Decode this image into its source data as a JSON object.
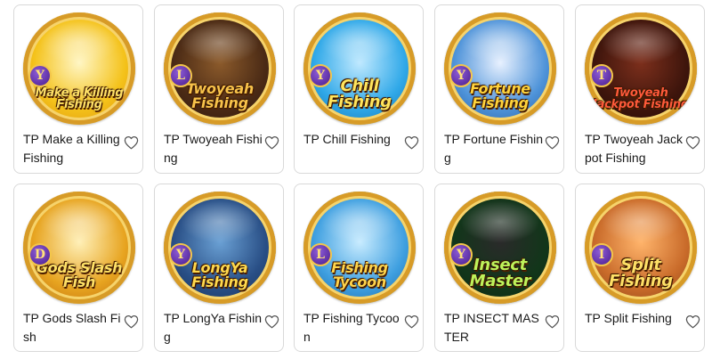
{
  "games": [
    {
      "title": "TP Make a Killing Fishing",
      "badge": "Y",
      "logo": "Make a Killing Fishing",
      "palette": [
        "#fff6c4",
        "#f4c21a",
        "#d9860a"
      ],
      "logo_color": "#ffe066"
    },
    {
      "title": "TP Twoyeah Fishing",
      "badge": "L",
      "logo": "Twoyeah Fishing",
      "palette": [
        "#8b5a2b",
        "#4a2a15",
        "#2a1408"
      ],
      "logo_color": "#f8c24a"
    },
    {
      "title": "TP Chill Fishing",
      "badge": "Y",
      "logo": "Chill Fishing",
      "palette": [
        "#bfe9ff",
        "#2fa8e8",
        "#11619c"
      ],
      "logo_color": "#ffe45c"
    },
    {
      "title": "TP Fortune Fishing",
      "badge": "Y",
      "logo": "Fortune Fishing",
      "palette": [
        "#e8f1ff",
        "#4e93d9",
        "#1e4f8f"
      ],
      "logo_color": "#ffd23a"
    },
    {
      "title": "TP Twoyeah Jackpot Fishing",
      "badge": "T",
      "logo": "Twoyeah Jackpot Fishing",
      "palette": [
        "#7c2f1c",
        "#3e150c",
        "#1d0804"
      ],
      "logo_color": "#ff5a3a"
    },
    {
      "title": "TP Gods Slash Fish",
      "badge": "D",
      "logo": "Gods Slash Fish",
      "palette": [
        "#fff0b8",
        "#e7a420",
        "#b45d0a"
      ],
      "logo_color": "#ffe066"
    },
    {
      "title": "TP LongYa Fishing",
      "badge": "Y",
      "logo": "LongYa Fishing",
      "palette": [
        "#6aa0d4",
        "#294f86",
        "#142848"
      ],
      "logo_color": "#ffd84c"
    },
    {
      "title": "TP Fishing Tycoon",
      "badge": "L",
      "logo": "Fishing Tycoon",
      "palette": [
        "#c9ecff",
        "#3e9fe0",
        "#17578f"
      ],
      "logo_color": "#ffd34a"
    },
    {
      "title": "TP INSECT MASTER",
      "badge": "Y",
      "logo": "Insect Master",
      "palette": [
        "#2a2a2a",
        "#12361a",
        "#0b2210"
      ],
      "logo_color": "#bff25a"
    },
    {
      "title": "TP Split Fishing",
      "badge": "I",
      "logo": "Split Fishing",
      "palette": [
        "#ffb46b",
        "#c96b2a",
        "#7a3a14"
      ],
      "logo_color": "#ffe066"
    }
  ]
}
